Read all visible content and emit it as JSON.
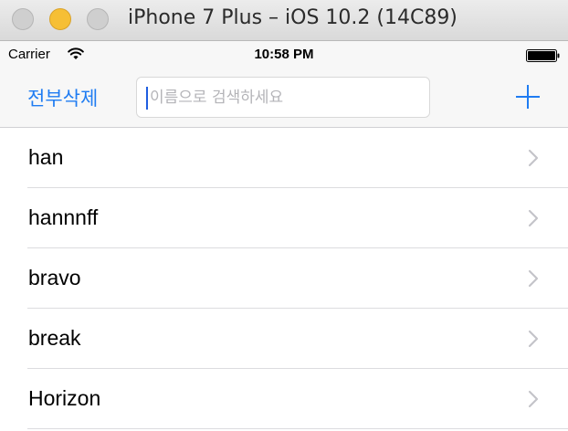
{
  "window": {
    "title": "iPhone 7 Plus – iOS 10.2 (14C89)"
  },
  "status_bar": {
    "carrier": "Carrier",
    "time": "10:58 PM",
    "icons": [
      "wifi-icon",
      "battery-icon"
    ]
  },
  "nav_bar": {
    "delete_all_label": "전부삭제",
    "search_placeholder": "이름으로 검색하세요",
    "search_value": "",
    "add_icon": "plus-icon",
    "accent_color": "#1f7cf2"
  },
  "table": {
    "rows": [
      {
        "label": "han"
      },
      {
        "label": "hannnff"
      },
      {
        "label": "bravo"
      },
      {
        "label": "break"
      },
      {
        "label": "Horizon"
      }
    ],
    "accessory_icon": "chevron-right-icon"
  }
}
